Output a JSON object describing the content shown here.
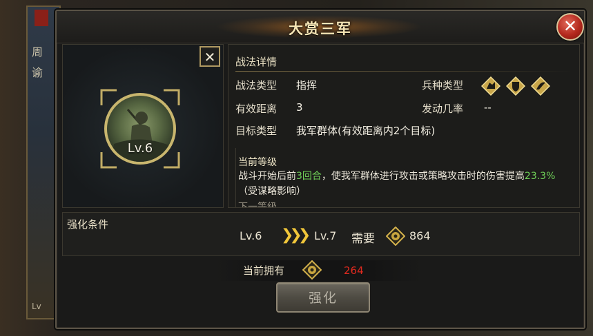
{
  "background": {
    "panel_chars": [
      "周",
      "谕"
    ],
    "lv_fragment": "Lv"
  },
  "dialog": {
    "title": "大赏三军",
    "close_icon": "close-icon"
  },
  "skill": {
    "level": "Lv.6",
    "panel_close_symbol": "✕"
  },
  "details": {
    "heading": "战法详情",
    "type_label": "战法类型",
    "type_value": "指挥",
    "range_label": "有效距离",
    "range_value": "3",
    "target_label": "目标类型",
    "target_value": "我军群体(有效距离内2个目标)",
    "troop_label": "兵种类型",
    "troop_icons": [
      "cavalry-icon",
      "shield-icon",
      "archer-icon"
    ],
    "trigger_label": "发动几率",
    "trigger_value": "--",
    "current_level_title": "当前等级",
    "desc_part1": "战斗开始后前",
    "desc_hl1": "3回合",
    "desc_part2": "，使我军群体进行攻击或策略攻击时的伤害提高",
    "desc_hl2": "23.3%",
    "desc_part3": "（受谋略影响）",
    "cut_text": "下一等级"
  },
  "upgrade": {
    "label": "强化条件",
    "from_level": "Lv.6",
    "to_level": "Lv.7",
    "need_label": "需要",
    "need_amount": "864",
    "owned_label": "当前拥有",
    "owned_amount": "264",
    "button_label": "强化"
  },
  "colors": {
    "highlight_green": "#6fcf58",
    "insufficient_red": "#e02a1f",
    "title_gold": "#f6e6b6"
  }
}
